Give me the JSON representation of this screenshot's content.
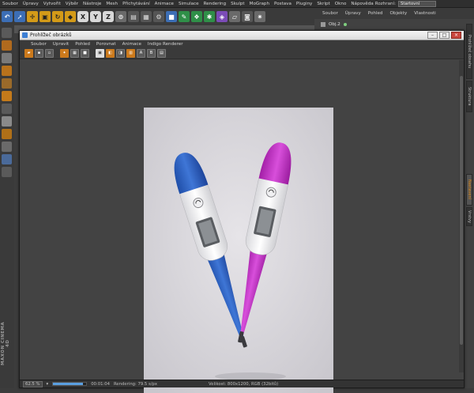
{
  "menubar": {
    "items": [
      "Soubor",
      "Úpravy",
      "Vytvořit",
      "Výběr",
      "Nástroje",
      "Mesh",
      "Přichytávání",
      "Animace",
      "Simulace",
      "Rendering",
      "Skulpt",
      "MoGraph",
      "Postava",
      "Pluginy",
      "Skript",
      "Okno",
      "Nápověda"
    ],
    "layout_label": "Rozhraní:",
    "layout_value": "Startovní"
  },
  "toolbar": {
    "axis_x": "X",
    "axis_y": "Y",
    "axis_z": "Z"
  },
  "object_manager": {
    "menu": [
      "Soubor",
      "Úpravy",
      "Pohled",
      "Objekty",
      "Vlastnosti"
    ],
    "object_name": "Obj.2"
  },
  "side_tabs": [
    "Prohlížeč obsahu",
    "Struktura",
    "Nastavení",
    "Vrstvy"
  ],
  "brand": "MAXON CINEMA 4D",
  "viewer": {
    "title": "Prohlížeč obrázků",
    "window_buttons": [
      "–",
      "□",
      "×"
    ],
    "menu": [
      "Soubor",
      "Upravit",
      "Pohled",
      "Porovnat",
      "Animace",
      "Indigo Renderer"
    ],
    "status": {
      "zoom": "62.5 %",
      "progress_fraction": 0.9,
      "time": "00:01:04",
      "rendering": "Rendering: 79.5 s/px",
      "size": "Velikost: 800x1200, RGB (32bitů)"
    }
  },
  "colors": {
    "bg": "#3c3c3c",
    "photo_bg": "#d9d7dc",
    "thermo_blue": "#2d5fc4",
    "thermo_magenta": "#c52fc7",
    "accent_orange": "#e08a18"
  }
}
